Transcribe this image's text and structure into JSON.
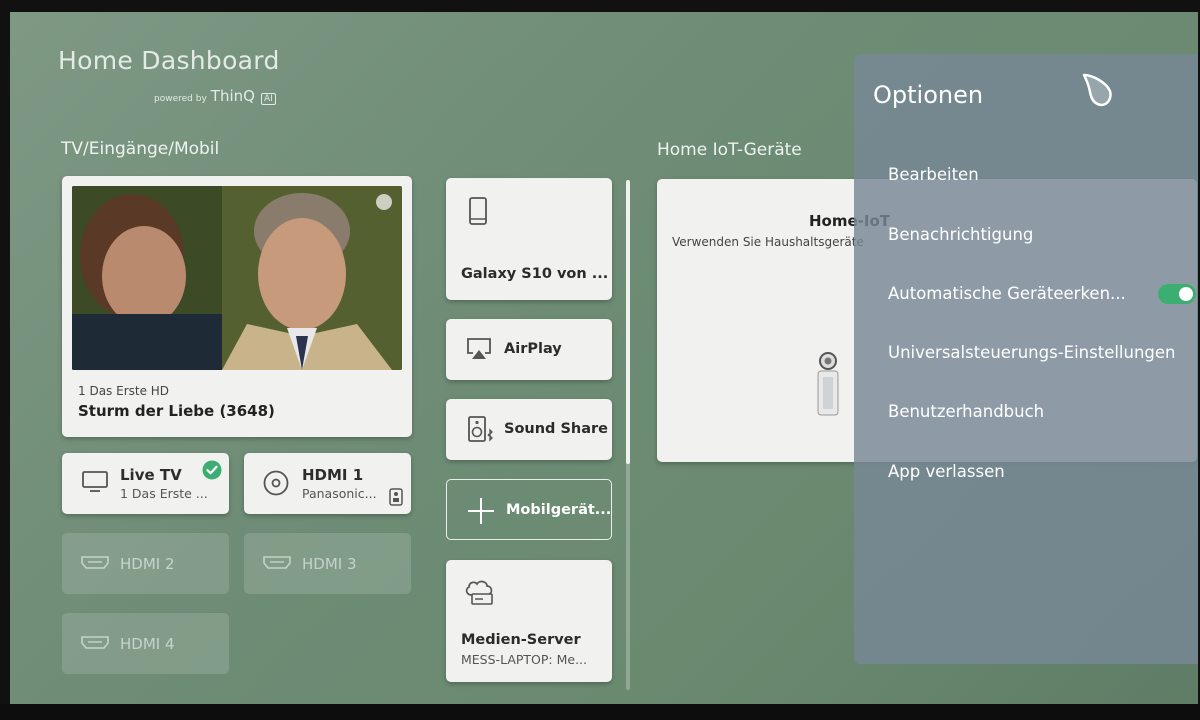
{
  "header": {
    "title": "Home Dashboard",
    "powered_by": "powered by",
    "brand": "ThinQ",
    "brand_badge": "AI"
  },
  "sections": {
    "inputs": "TV/Eingänge/Mobil",
    "iot": "Home IoT-Geräte"
  },
  "now_playing": {
    "channel": "1 Das Erste HD",
    "program": "Sturm der Liebe (3648)"
  },
  "inputs": [
    {
      "label": "Live TV",
      "sub": "1 Das Erste ...",
      "icon": "tv-icon",
      "active": true
    },
    {
      "label": "HDMI 1",
      "sub": "Panasonic...",
      "icon": "disc-icon",
      "active": true
    },
    {
      "label": "HDMI 2",
      "icon": "hdmi-icon",
      "active": false
    },
    {
      "label": "HDMI 3",
      "icon": "hdmi-icon",
      "active": false
    },
    {
      "label": "HDMI 4",
      "icon": "hdmi-icon",
      "active": false
    }
  ],
  "mobile": [
    {
      "label": "Galaxy S10 von ...",
      "icon": "phone-icon"
    },
    {
      "label": "AirPlay",
      "icon": "airplay-icon"
    },
    {
      "label": "Sound Share",
      "icon": "speaker-bluetooth-icon"
    },
    {
      "label": "Mobilgerät...",
      "icon": "plus-icon"
    },
    {
      "label": "Medien-Server",
      "sub": "MESS-LAPTOP: Me...",
      "icon": "cloud-server-icon"
    }
  ],
  "iot_card": {
    "title": "Home-IoT",
    "desc": "Verwenden Sie Haushaltsgeräte"
  },
  "options_panel": {
    "title": "Optionen",
    "items": [
      {
        "label": "Bearbeiten"
      },
      {
        "label": "Benachrichtigung"
      },
      {
        "label": "Automatische Geräteerken...",
        "toggle": true
      },
      {
        "label": "Universalsteuerungs-Einstellungen"
      },
      {
        "label": "Benutzerhandbuch"
      },
      {
        "label": "App verlassen"
      }
    ]
  },
  "colors": {
    "background": "#6e8c76",
    "card": "#f1f1f0",
    "panel": "#78889a",
    "toggle_on": "#3dae72",
    "check": "#3dae72"
  }
}
